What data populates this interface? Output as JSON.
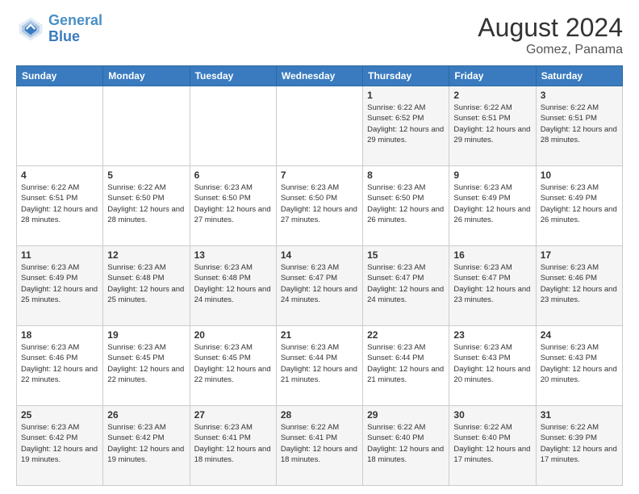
{
  "header": {
    "logo_line1": "General",
    "logo_line2": "Blue",
    "month": "August 2024",
    "location": "Gomez, Panama"
  },
  "weekdays": [
    "Sunday",
    "Monday",
    "Tuesday",
    "Wednesday",
    "Thursday",
    "Friday",
    "Saturday"
  ],
  "weeks": [
    [
      {
        "day": "",
        "info": ""
      },
      {
        "day": "",
        "info": ""
      },
      {
        "day": "",
        "info": ""
      },
      {
        "day": "",
        "info": ""
      },
      {
        "day": "1",
        "info": "Sunrise: 6:22 AM\nSunset: 6:52 PM\nDaylight: 12 hours\nand 29 minutes."
      },
      {
        "day": "2",
        "info": "Sunrise: 6:22 AM\nSunset: 6:51 PM\nDaylight: 12 hours\nand 29 minutes."
      },
      {
        "day": "3",
        "info": "Sunrise: 6:22 AM\nSunset: 6:51 PM\nDaylight: 12 hours\nand 28 minutes."
      }
    ],
    [
      {
        "day": "4",
        "info": "Sunrise: 6:22 AM\nSunset: 6:51 PM\nDaylight: 12 hours\nand 28 minutes."
      },
      {
        "day": "5",
        "info": "Sunrise: 6:22 AM\nSunset: 6:50 PM\nDaylight: 12 hours\nand 28 minutes."
      },
      {
        "day": "6",
        "info": "Sunrise: 6:23 AM\nSunset: 6:50 PM\nDaylight: 12 hours\nand 27 minutes."
      },
      {
        "day": "7",
        "info": "Sunrise: 6:23 AM\nSunset: 6:50 PM\nDaylight: 12 hours\nand 27 minutes."
      },
      {
        "day": "8",
        "info": "Sunrise: 6:23 AM\nSunset: 6:50 PM\nDaylight: 12 hours\nand 26 minutes."
      },
      {
        "day": "9",
        "info": "Sunrise: 6:23 AM\nSunset: 6:49 PM\nDaylight: 12 hours\nand 26 minutes."
      },
      {
        "day": "10",
        "info": "Sunrise: 6:23 AM\nSunset: 6:49 PM\nDaylight: 12 hours\nand 26 minutes."
      }
    ],
    [
      {
        "day": "11",
        "info": "Sunrise: 6:23 AM\nSunset: 6:49 PM\nDaylight: 12 hours\nand 25 minutes."
      },
      {
        "day": "12",
        "info": "Sunrise: 6:23 AM\nSunset: 6:48 PM\nDaylight: 12 hours\nand 25 minutes."
      },
      {
        "day": "13",
        "info": "Sunrise: 6:23 AM\nSunset: 6:48 PM\nDaylight: 12 hours\nand 24 minutes."
      },
      {
        "day": "14",
        "info": "Sunrise: 6:23 AM\nSunset: 6:47 PM\nDaylight: 12 hours\nand 24 minutes."
      },
      {
        "day": "15",
        "info": "Sunrise: 6:23 AM\nSunset: 6:47 PM\nDaylight: 12 hours\nand 24 minutes."
      },
      {
        "day": "16",
        "info": "Sunrise: 6:23 AM\nSunset: 6:47 PM\nDaylight: 12 hours\nand 23 minutes."
      },
      {
        "day": "17",
        "info": "Sunrise: 6:23 AM\nSunset: 6:46 PM\nDaylight: 12 hours\nand 23 minutes."
      }
    ],
    [
      {
        "day": "18",
        "info": "Sunrise: 6:23 AM\nSunset: 6:46 PM\nDaylight: 12 hours\nand 22 minutes."
      },
      {
        "day": "19",
        "info": "Sunrise: 6:23 AM\nSunset: 6:45 PM\nDaylight: 12 hours\nand 22 minutes."
      },
      {
        "day": "20",
        "info": "Sunrise: 6:23 AM\nSunset: 6:45 PM\nDaylight: 12 hours\nand 22 minutes."
      },
      {
        "day": "21",
        "info": "Sunrise: 6:23 AM\nSunset: 6:44 PM\nDaylight: 12 hours\nand 21 minutes."
      },
      {
        "day": "22",
        "info": "Sunrise: 6:23 AM\nSunset: 6:44 PM\nDaylight: 12 hours\nand 21 minutes."
      },
      {
        "day": "23",
        "info": "Sunrise: 6:23 AM\nSunset: 6:43 PM\nDaylight: 12 hours\nand 20 minutes."
      },
      {
        "day": "24",
        "info": "Sunrise: 6:23 AM\nSunset: 6:43 PM\nDaylight: 12 hours\nand 20 minutes."
      }
    ],
    [
      {
        "day": "25",
        "info": "Sunrise: 6:23 AM\nSunset: 6:42 PM\nDaylight: 12 hours\nand 19 minutes."
      },
      {
        "day": "26",
        "info": "Sunrise: 6:23 AM\nSunset: 6:42 PM\nDaylight: 12 hours\nand 19 minutes."
      },
      {
        "day": "27",
        "info": "Sunrise: 6:23 AM\nSunset: 6:41 PM\nDaylight: 12 hours\nand 18 minutes."
      },
      {
        "day": "28",
        "info": "Sunrise: 6:22 AM\nSunset: 6:41 PM\nDaylight: 12 hours\nand 18 minutes."
      },
      {
        "day": "29",
        "info": "Sunrise: 6:22 AM\nSunset: 6:40 PM\nDaylight: 12 hours\nand 18 minutes."
      },
      {
        "day": "30",
        "info": "Sunrise: 6:22 AM\nSunset: 6:40 PM\nDaylight: 12 hours\nand 17 minutes."
      },
      {
        "day": "31",
        "info": "Sunrise: 6:22 AM\nSunset: 6:39 PM\nDaylight: 12 hours\nand 17 minutes."
      }
    ]
  ]
}
